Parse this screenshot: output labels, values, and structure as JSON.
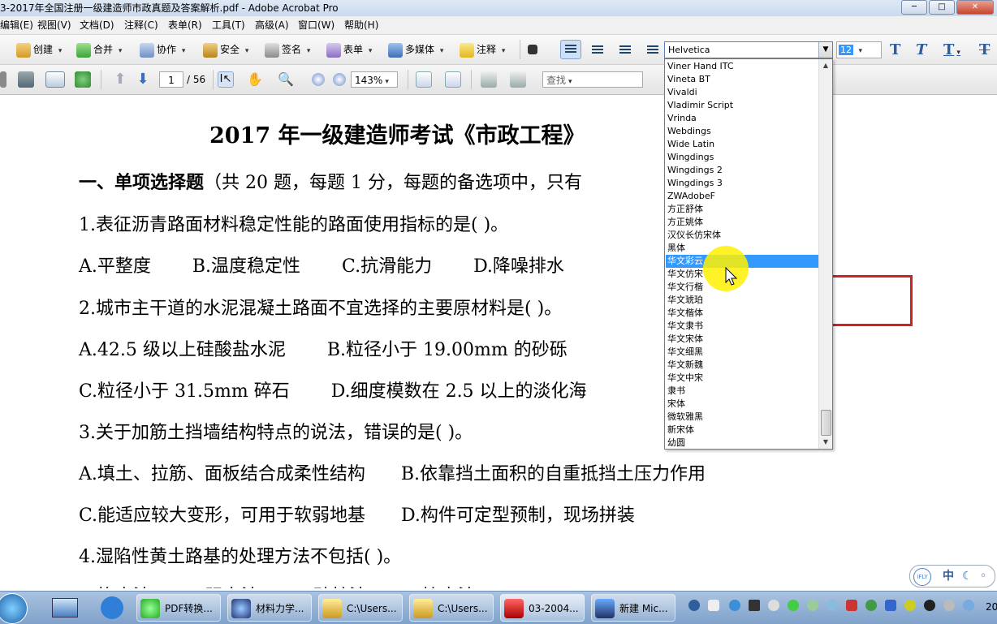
{
  "window": {
    "title": "3-2017年全国注册一级建造师市政真题及答案解析.pdf - Adobe Acrobat Pro"
  },
  "menu": [
    "编辑(E)",
    "视图(V)",
    "文档(D)",
    "注释(C)",
    "表单(R)",
    "工具(T)",
    "高级(A)",
    "窗口(W)",
    "帮助(H)"
  ],
  "toolbar": {
    "create": "创建",
    "combine": "合并",
    "collaborate": "协作",
    "secure": "安全",
    "sign": "签名",
    "forms": "表单",
    "multimedia": "多媒体",
    "comment": "注释"
  },
  "nav": {
    "page_current": "1",
    "page_total": "/ 56",
    "zoom": "143%",
    "find_placeholder": "查找"
  },
  "font": {
    "current": "Helvetica",
    "size": "12",
    "options": [
      "Viner Hand ITC",
      "Vineta BT",
      "Vivaldi",
      "Vladimir Script",
      "Vrinda",
      "Webdings",
      "Wide Latin",
      "Wingdings",
      "Wingdings 2",
      "Wingdings 3",
      "ZWAdobeF",
      "方正舒体",
      "方正姚体",
      "汉仪长仿宋体",
      "黑体",
      "华文彩云",
      "华文仿宋",
      "华文行楷",
      "华文琥珀",
      "华文楷体",
      "华文隶书",
      "华文宋体",
      "华文细黑",
      "华文新魏",
      "华文中宋",
      "隶书",
      "宋体",
      "微软雅黑",
      "新宋体",
      "幼圆"
    ],
    "selected_index": 15
  },
  "document": {
    "title": "2017 年一级建造师考试《市政工程》",
    "section": "一、单项选择题",
    "section_note": "（共 20 题，每题 1 分，每题的备选项中，只有",
    "lines": [
      "1.表征沥青路面材料稳定性能的路面使用指标的是( )。",
      "A.平整度　　 B.温度稳定性　　 C.抗滑能力　　 D.降噪排水",
      "2.城市主干道的水泥混凝土路面不宜选择的主要原材料是( )。",
      "A.42.5 级以上硅酸盐水泥　　 B.粒径小于 19.00mm 的砂砾",
      "C.粒径小于 31.5mm 碎石　　 D.细度模数在 2.5 以上的淡化海",
      "3.关于加筋土挡墙结构特点的说法，错误的是( )。",
      "A.填土、拉筋、面板结合成柔性结构　　B.依靠挡土面积的自重抵挡土压力作用",
      "C.能适应较大变形，可用于软弱地基　　D.构件可定型预制，现场拼装",
      "4.湿陷性黄土路基的处理方法不包括( )。",
      "A.换土法　　B.强夯法　　C.砂桩法　　D.挤密法"
    ]
  },
  "taskbar": {
    "tasks": [
      "PDF转换...",
      "材料力学...",
      "C:\\Users...",
      "C:\\Users...",
      "03-2004...",
      "新建 Mic..."
    ],
    "clock": "20"
  },
  "ime": {
    "label": "中"
  },
  "colors": {
    "selection": "#3399ff",
    "highlight": "#fff000",
    "red_box": "#d02020"
  }
}
